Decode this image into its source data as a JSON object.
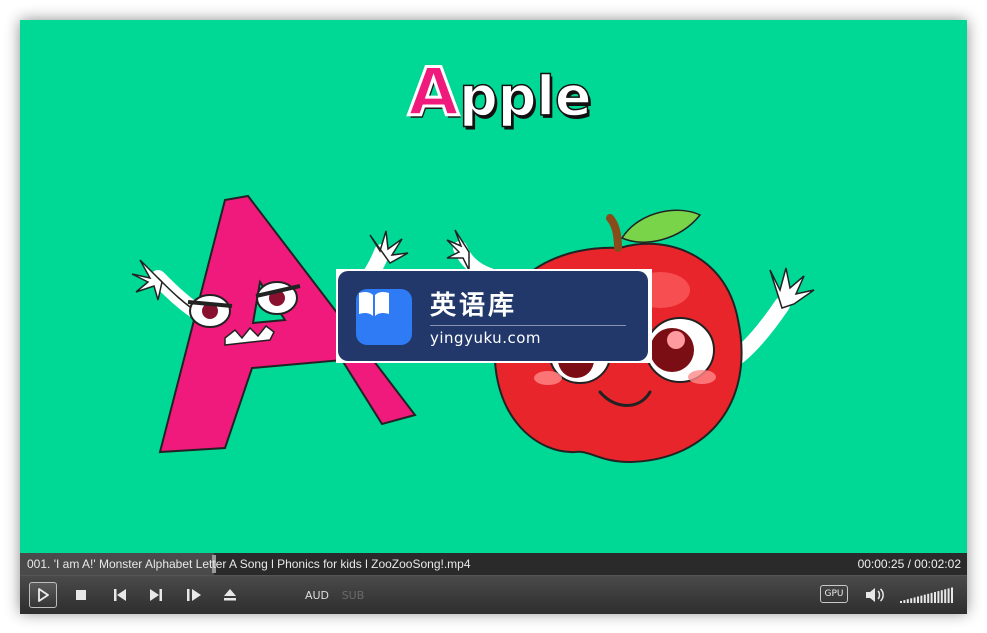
{
  "video": {
    "title_first_letter": "A",
    "title_rest": "pple",
    "background": "#00d895",
    "letter_color": "#f0197c",
    "apple_color": "#e8252b"
  },
  "watermark": {
    "name": "英语库",
    "url": "yingyuku.com",
    "icon": "book-icon"
  },
  "infobar": {
    "filename": "001. 'I am A!' Monster Alphabet Letter A Song l Phonics for kids l ZooZooSong!.mp4",
    "time": "00:00:25 / 00:02:02",
    "progress_fraction": 0.205
  },
  "controls": {
    "play": "play-icon",
    "stop": "stop-icon",
    "prev": "previous-icon",
    "next": "next-icon",
    "frame_step": "frame-step-icon",
    "eject": "eject-icon",
    "aud_label": "AUD",
    "sub_label": "SUB",
    "gpu_label": "GPU",
    "volume": "speaker-icon",
    "volume_level": 1.0
  }
}
